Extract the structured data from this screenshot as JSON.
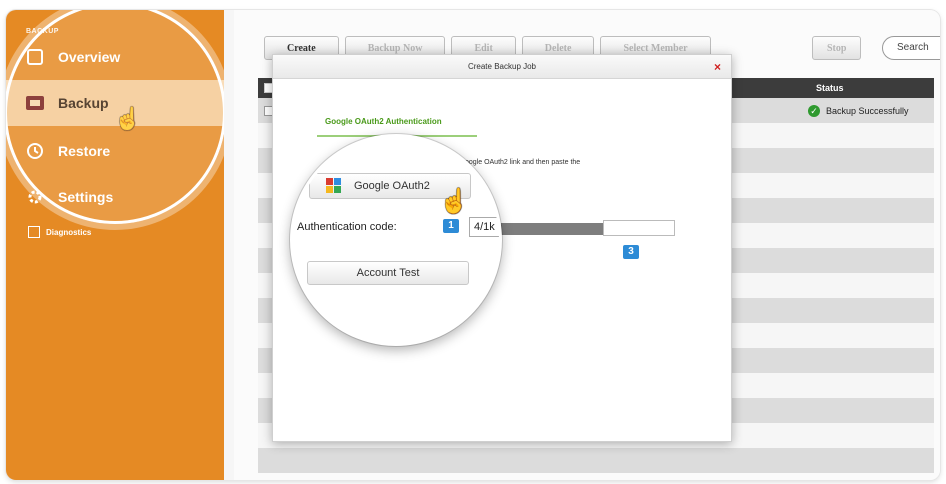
{
  "sidebar": {
    "brand": "BACKUP",
    "items": [
      {
        "label": "Overview",
        "icon": "overview-icon"
      },
      {
        "label": "Backup",
        "icon": "backup-icon"
      },
      {
        "label": "Restore",
        "icon": "restore-icon"
      },
      {
        "label": "Settings",
        "icon": "gear-icon"
      },
      {
        "label": "Diagnostics",
        "icon": "diagnostics-icon"
      }
    ]
  },
  "toolbar": {
    "create": "Create",
    "backup_now": "Backup Now",
    "edit": "Edit",
    "delete": "Delete",
    "select_member": "Select Member",
    "stop": "Stop",
    "search_placeholder": "Search"
  },
  "grid": {
    "status_header": "Status",
    "rows": [
      {
        "status": "Backup Successfully"
      }
    ]
  },
  "dialog": {
    "title": "Create Backup Job",
    "close": "×",
    "tab": "Google OAuth2 Authentication",
    "instruction": "oogle OAuth2 link and then paste the",
    "oauth_button": "Google OAuth2",
    "auth_label": "Authentication code:",
    "auth_value": "4/1k",
    "test_button": "Account Test",
    "step1": "1",
    "step3": "3"
  },
  "colors": {
    "sidebar": "#e58a24",
    "selected": "#f5c993",
    "badge": "#2d8bd6"
  }
}
